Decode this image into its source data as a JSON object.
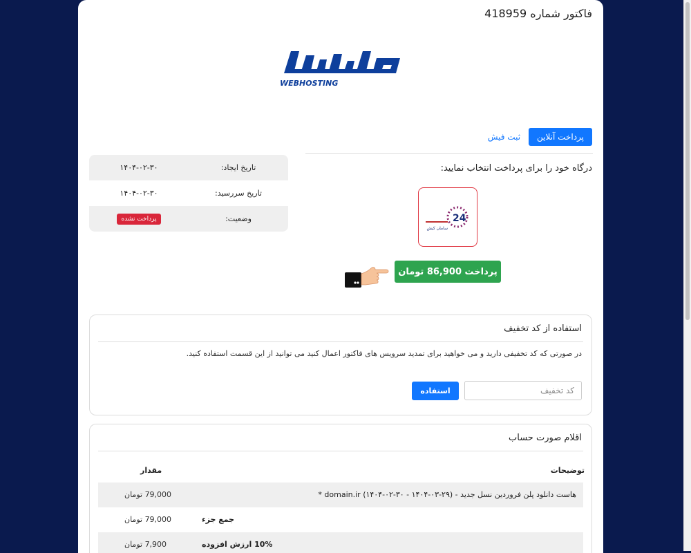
{
  "invoice": {
    "title": "فاکتور شماره 418959"
  },
  "logo": {
    "brand": "میزبان فا",
    "sub": "WEBHOSTING"
  },
  "tabs": {
    "online_pay": "پرداخت آنلاین",
    "receipt": "ثبت فیش"
  },
  "gateway": {
    "title": "درگاه خود را برای پرداخت انتخاب نمایید:",
    "pay_button": "پرداخت 86,900 تومان",
    "logo_number": "24",
    "logo_name": "سامان کیش"
  },
  "info": {
    "created_label": "تاریخ ایجاد:",
    "created_value": "۱۴۰۴-۰۲-۳۰",
    "due_label": "تاریخ سررسید:",
    "due_value": "۱۴۰۴-۰۲-۳۰",
    "status_label": "وضعیت:",
    "status_value": "پرداخت نشده"
  },
  "coupon": {
    "title": "استفاده از کد تخفیف",
    "description": "در صورتی که کد تخفیفی دارید و می خواهید برای تمدید سرویس های فاکتور اعمال کنید می توانید از این قسمت استفاده کنید.",
    "placeholder": "کد تخفیف",
    "button": "استفاده"
  },
  "items": {
    "title": "اقلام صورت حساب",
    "col_desc": "توضیحات",
    "col_amount": "مقدار",
    "rows": [
      {
        "description": "هاست دانلود پلن فروردین نسل جدید - domain.ir (۱۴۰۴-۰۲-۳۰ - ۱۴۰۴-۰۳-۲۹) *",
        "amount": "79,000 تومان"
      }
    ],
    "subtotal_label": "جمع جزء",
    "subtotal_value": "79,000 تومان",
    "tax_label": "10% ارزش افزوده",
    "tax_value": "7,900 تومان"
  },
  "colors": {
    "primary": "#1177ff",
    "success": "#2ea44f",
    "danger": "#d9263a",
    "background": "#0a1a4e"
  }
}
